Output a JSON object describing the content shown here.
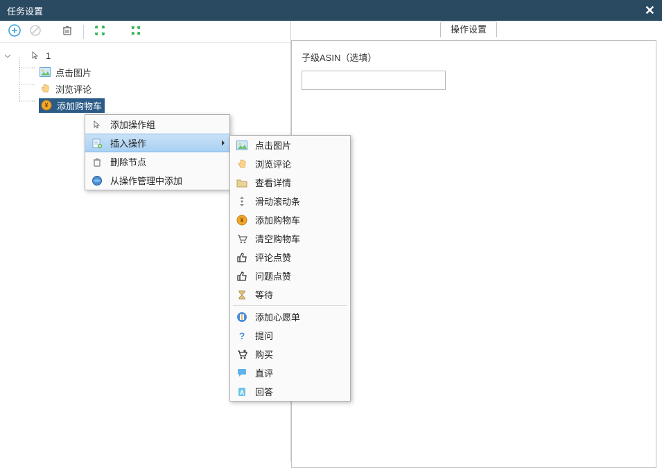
{
  "window": {
    "title": "任务设置"
  },
  "tree": {
    "root": "1",
    "items": [
      {
        "label": "点击图片"
      },
      {
        "label": "浏览评论"
      },
      {
        "label": "添加购物车"
      }
    ]
  },
  "context_menu": {
    "items": [
      {
        "label": "添加操作组"
      },
      {
        "label": "插入操作"
      },
      {
        "label": "删除节点"
      },
      {
        "label": "从操作管理中添加"
      }
    ]
  },
  "submenu": {
    "items": [
      {
        "label": "点击图片"
      },
      {
        "label": "浏览评论"
      },
      {
        "label": "查看详情"
      },
      {
        "label": "滑动滚动条"
      },
      {
        "label": "添加购物车"
      },
      {
        "label": "清空购物车"
      },
      {
        "label": "评论点赞"
      },
      {
        "label": "问题点赞"
      },
      {
        "label": "等待"
      },
      {
        "label": "添加心愿单"
      },
      {
        "label": "提问"
      },
      {
        "label": "购买"
      },
      {
        "label": "直评"
      },
      {
        "label": "回答"
      }
    ]
  },
  "right": {
    "tab": "操作设置",
    "field_label": "子级ASIN（选填）",
    "field_value": ""
  },
  "colors": {
    "titlebar": "#2a4a62",
    "selection": "#2b5b87",
    "highlight": "#b6d8f4"
  }
}
